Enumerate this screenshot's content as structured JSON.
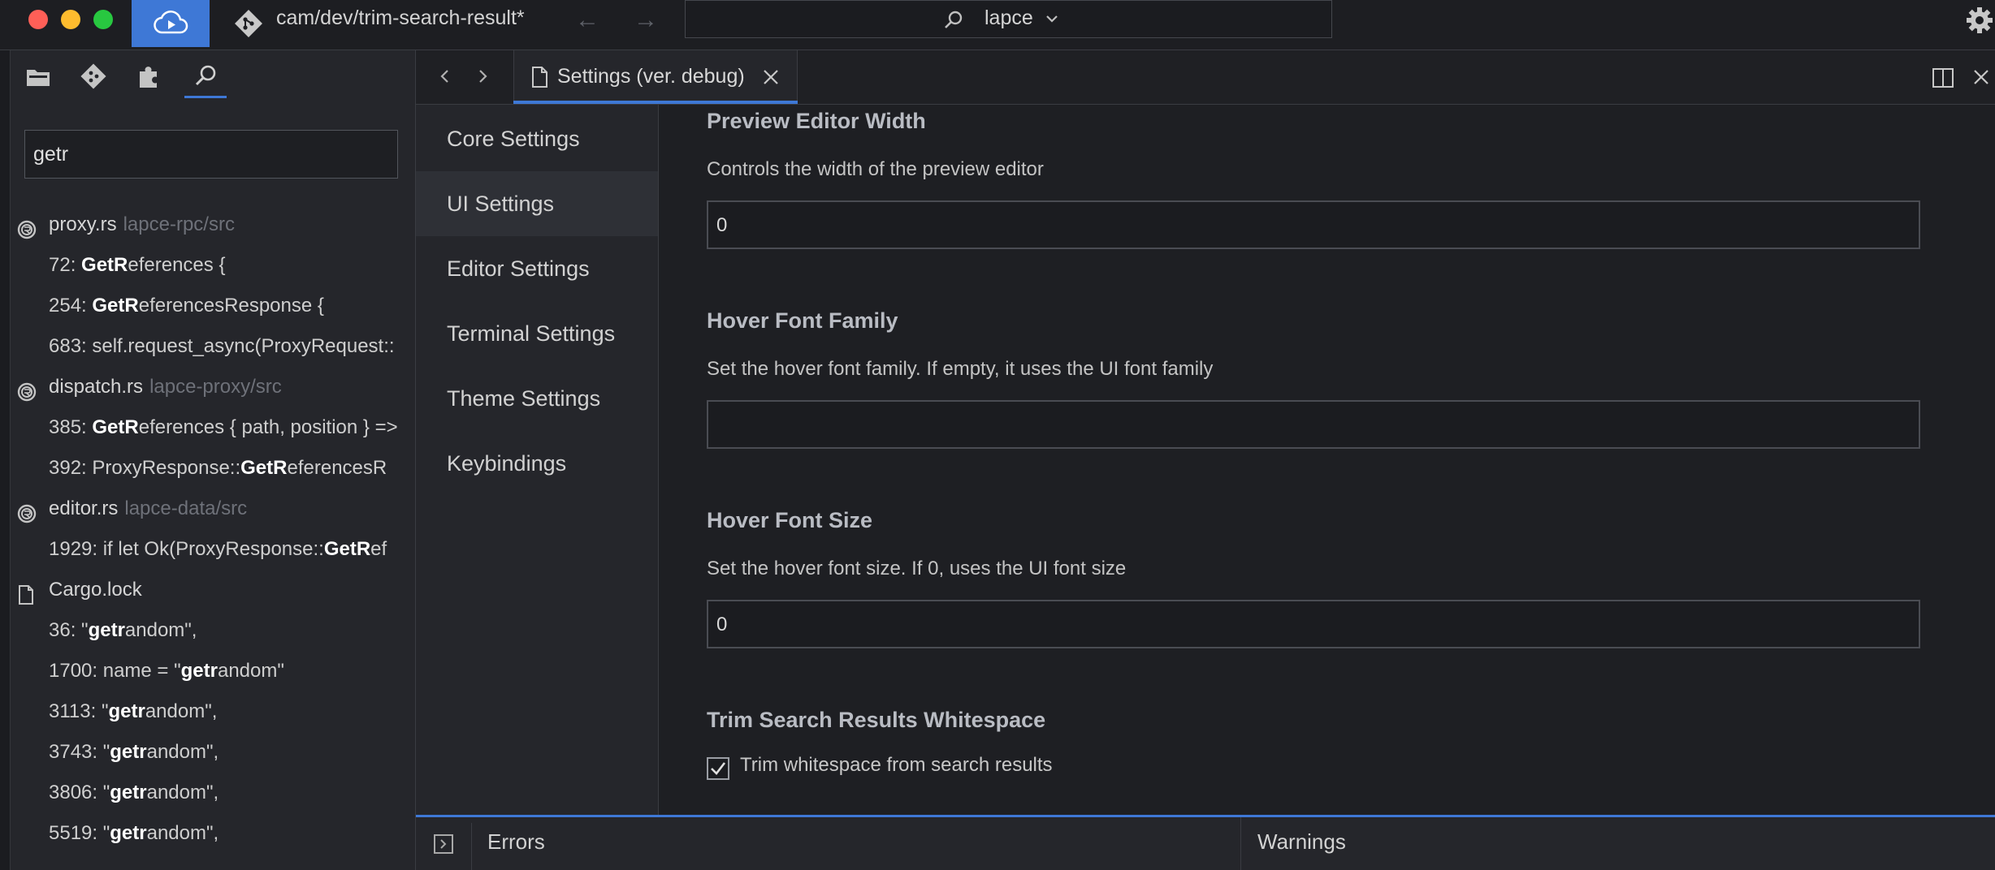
{
  "titlebar": {
    "branch": "cam/dev/trim-search-result*",
    "workspace": "lapce",
    "colors": {
      "close": "#ff5f57",
      "minimize": "#febc2e",
      "maximize": "#28c840",
      "accent": "#3e78d6"
    },
    "icons": {
      "remote": "cloud-icon",
      "branch": "git-icon",
      "back": "arrow-left-icon",
      "forward": "arrow-right-icon",
      "search": "search-icon",
      "chevron": "chevron-down-icon",
      "settings": "gear-icon"
    }
  },
  "left_panel": {
    "tabs": [
      "folder-icon",
      "source-control-icon",
      "extensions-icon",
      "search-icon"
    ],
    "search": {
      "value": "getr",
      "placeholder": ""
    },
    "results": [
      {
        "type": "file",
        "icon": "rust-icon",
        "name": "proxy.rs",
        "path": "lapce-rpc/src"
      },
      {
        "type": "match",
        "pre": "72: ",
        "hl": "GetR",
        "post": "eferences {"
      },
      {
        "type": "match",
        "pre": "254: ",
        "hl": "GetR",
        "post": "eferencesResponse {"
      },
      {
        "type": "match",
        "pre": "683: self.request_async(ProxyRequest::",
        "hl": "",
        "post": ""
      },
      {
        "type": "file",
        "icon": "rust-icon",
        "name": "dispatch.rs",
        "path": "lapce-proxy/src"
      },
      {
        "type": "match",
        "pre": "385: ",
        "hl": "GetR",
        "post": "eferences { path, position } =>"
      },
      {
        "type": "match",
        "pre": "392: ProxyResponse::",
        "hl": "GetR",
        "post": "eferencesR"
      },
      {
        "type": "file",
        "icon": "rust-icon",
        "name": "editor.rs",
        "path": "lapce-data/src"
      },
      {
        "type": "match",
        "pre": "1929: if let Ok(ProxyResponse::",
        "hl": "GetR",
        "post": "ef"
      },
      {
        "type": "file",
        "icon": "file-icon",
        "name": "Cargo.lock",
        "path": ""
      },
      {
        "type": "match",
        "pre": "36: \"",
        "hl": "getr",
        "post": "andom\","
      },
      {
        "type": "match",
        "pre": "1700: name = \"",
        "hl": "getr",
        "post": "andom\""
      },
      {
        "type": "match",
        "pre": "3113: \"",
        "hl": "getr",
        "post": "andom\","
      },
      {
        "type": "match",
        "pre": "3743: \"",
        "hl": "getr",
        "post": "andom\","
      },
      {
        "type": "match",
        "pre": "3806: \"",
        "hl": "getr",
        "post": "andom\","
      },
      {
        "type": "match",
        "pre": "5519: \"",
        "hl": "getr",
        "post": "andom\","
      }
    ]
  },
  "editor": {
    "tab_label": "Settings (ver. debug)",
    "icons": {
      "back": "chevron-left-icon",
      "forward": "chevron-right-icon",
      "tab_file": "file-icon",
      "tab_close": "close-icon",
      "split": "split-editor-icon",
      "close": "close-icon"
    }
  },
  "settings_nav": [
    {
      "label": "Core Settings",
      "active": false
    },
    {
      "label": "UI Settings",
      "active": true
    },
    {
      "label": "Editor Settings",
      "active": false
    },
    {
      "label": "Terminal Settings",
      "active": false
    },
    {
      "label": "Theme Settings",
      "active": false
    },
    {
      "label": "Keybindings",
      "active": false
    }
  ],
  "settings": {
    "preview_width": {
      "title": "Preview Editor Width",
      "desc": "Controls the width of the preview editor",
      "value": "0"
    },
    "hover_font_family": {
      "title": "Hover Font Family",
      "desc": "Set the hover font family. If empty, it uses the UI font family",
      "value": ""
    },
    "hover_font_size": {
      "title": "Hover Font Size",
      "desc": "Set the hover font size. If 0, uses the UI font size",
      "value": "0"
    },
    "trim_whitespace": {
      "title": "Trim Search Results Whitespace",
      "label": "Trim whitespace from search results",
      "checked": true
    }
  },
  "bottom_panel": {
    "errors": "Errors",
    "warnings": "Warnings"
  }
}
